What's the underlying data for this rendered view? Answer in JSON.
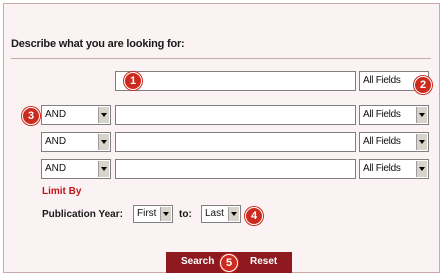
{
  "form": {
    "heading": "Describe what you are looking for:",
    "rows": [
      {
        "operator": "",
        "term": "",
        "field": "All Fields"
      },
      {
        "operator": "AND",
        "term": "",
        "field": "All Fields"
      },
      {
        "operator": "AND",
        "term": "",
        "field": "All Fields"
      },
      {
        "operator": "AND",
        "term": "",
        "field": "All Fields"
      }
    ],
    "limit_by": "Limit By",
    "publication_year_label": "Publication Year:",
    "year_from": "First",
    "to_label": "to:",
    "year_to": "Last"
  },
  "buttons": {
    "search": "Search",
    "reset": "Reset"
  },
  "badges": [
    "1",
    "2",
    "3",
    "4",
    "5"
  ],
  "colors": {
    "panel_bg": "#fbf3f3",
    "border": "#c9a9a9",
    "accent_red": "#c0141c",
    "button_bar": "#8e1a1f",
    "badge": "#cc2a1e"
  }
}
